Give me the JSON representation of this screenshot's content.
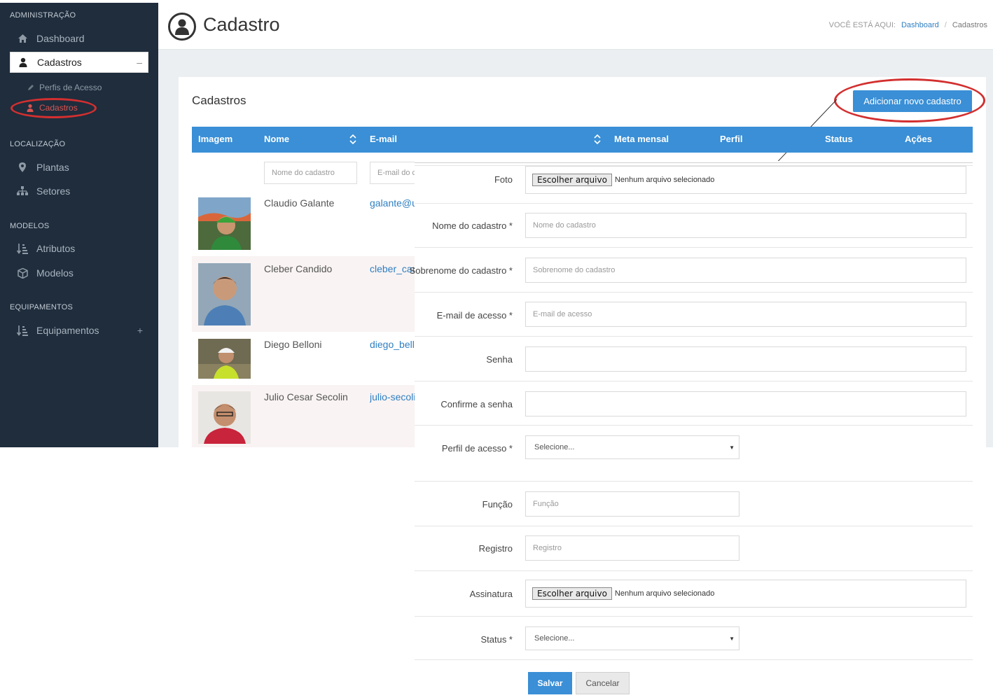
{
  "sidebar": {
    "sections": {
      "admin": "ADMINISTRAÇÃO",
      "localizacao": "LOCALIZAÇÃO",
      "modelos": "MODELOS",
      "equipamentos": "EQUIPAMENTOS"
    },
    "items": {
      "dashboard": "Dashboard",
      "cadastros": "Cadastros",
      "cadastros_toggle": "–",
      "perfis": "Perfis de Acesso",
      "cadastros_sub": "Cadastros",
      "plantas": "Plantas",
      "setores": "Setores",
      "atributos": "Atributos",
      "modelos": "Modelos",
      "equipamentos": "Equipamentos",
      "equipamentos_toggle": "+"
    }
  },
  "header": {
    "title": "Cadastro",
    "breadcrumb_label": "VOCÊ ESTÁ AQUI:",
    "breadcrumb_link": "Dashboard",
    "breadcrumb_sep": "/",
    "breadcrumb_current": "Cadastros"
  },
  "panel": {
    "title": "Cadastros",
    "add_button": "Adicionar novo cadastro"
  },
  "table": {
    "headers": {
      "imagem": "Imagem",
      "nome": "Nome",
      "email": "E-mail",
      "meta": "Meta mensal",
      "perfil": "Perfil",
      "status": "Status",
      "acoes": "Ações"
    },
    "filters": {
      "nome": "Nome do cadastro",
      "email": "E-mail do c"
    },
    "rows": [
      {
        "name": "Claudio Galante",
        "email": "galante@ur"
      },
      {
        "name": "Cleber Candido",
        "email": "cleber_canc"
      },
      {
        "name": "Diego Belloni",
        "email": "diego_bello"
      },
      {
        "name": "Julio Cesar Secolin",
        "email": "julio-secoli"
      }
    ]
  },
  "form": {
    "foto_label": "Foto",
    "file_button": "Escolher arquivo",
    "file_none": "Nenhum arquivo selecionado",
    "nome_label": "Nome do cadastro *",
    "nome_placeholder": "Nome do cadastro",
    "sobrenome_label": "Sobrenome do cadastro *",
    "sobrenome_placeholder": "Sobrenome do cadastro",
    "email_label": "E-mail de acesso *",
    "email_placeholder": "E-mail de acesso",
    "senha_label": "Senha",
    "confirme_label": "Confirme a senha",
    "perfil_label": "Perfil de acesso *",
    "select_default": "Selecione...",
    "funcao_label": "Função",
    "funcao_placeholder": "Função",
    "registro_label": "Registro",
    "registro_placeholder": "Registro",
    "assinatura_label": "Assinatura",
    "status_label": "Status *",
    "save": "Salvar",
    "cancel": "Cancelar"
  }
}
